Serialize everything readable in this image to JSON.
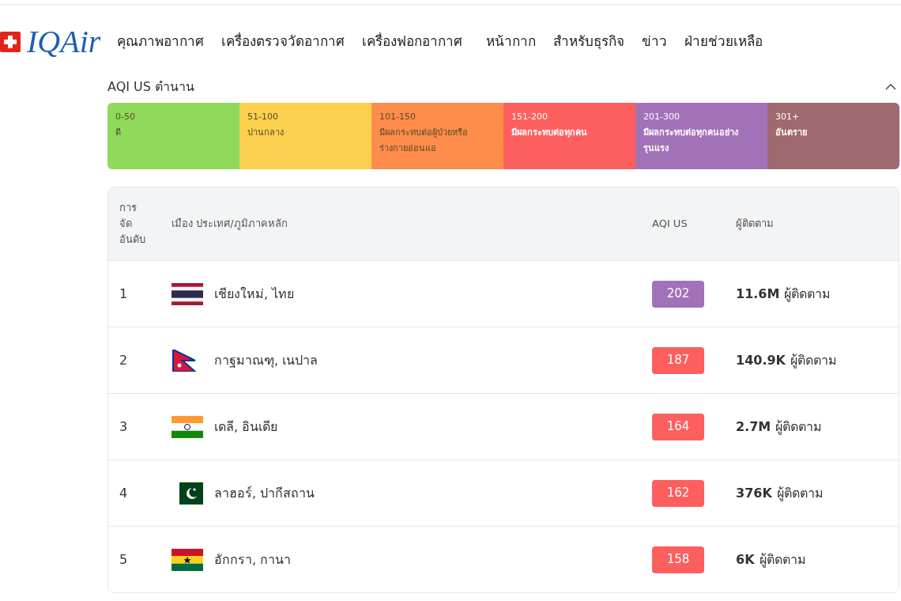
{
  "logo": {
    "text": "IQAir"
  },
  "nav": [
    "คุณภาพอากาศ",
    "เครื่องตรวจวัดอากาศ",
    "เครื่องฟอกอากาศ",
    "หน้ากาก",
    "สำหรับธุรกิจ",
    "ข่าว",
    "ฝ่ายช่วยเหลือ"
  ],
  "legend": {
    "title": "AQI US ตำนาน",
    "expanded": true,
    "items": [
      {
        "range": "0-50",
        "label": "ดี",
        "color": "#8fd95b"
      },
      {
        "range": "51-100",
        "label": "ปานกลาง",
        "color": "#fbd04e"
      },
      {
        "range": "101-150",
        "label": "มีผลกระทบต่อผู้ป่วยหรือร่างกายอ่อนแอ",
        "color": "#fe8c4a"
      },
      {
        "range": "151-200",
        "label": "มีผลกระทบต่อทุกคน",
        "color": "#fd5f5f"
      },
      {
        "range": "201-300",
        "label": "มีผลกระทบต่อทุกคนอย่างรุนแรง",
        "color": "#a272b8"
      },
      {
        "range": "301+",
        "label": "อันตราย",
        "color": "#a0686f"
      }
    ]
  },
  "table": {
    "columns": [
      "การ จัด อันดับ",
      "เมือง ประเทศ/ภูมิภาคหลัก",
      "AQI US",
      "ผู้ติดตาม"
    ],
    "rows": [
      {
        "rank": "1",
        "city": "เชียงใหม่, ไทย",
        "aqi": "202",
        "color": "#a272b8",
        "followers": "11.6M",
        "followers_label": "ผู้ติดตาม"
      },
      {
        "rank": "2",
        "city": "กาฐมาณฑุ, เนปาล",
        "aqi": "187",
        "color": "#fd5f5f",
        "followers": "140.9K",
        "followers_label": "ผู้ติดตาม"
      },
      {
        "rank": "3",
        "city": "เดลี, อินเดีย",
        "aqi": "164",
        "color": "#fd5f5f",
        "followers": "2.7M",
        "followers_label": "ผู้ติดตาม"
      },
      {
        "rank": "4",
        "city": "ลาฮอร์, ปากีสถาน",
        "aqi": "162",
        "color": "#fd5f5f",
        "followers": "376K",
        "followers_label": "ผู้ติดตาม"
      },
      {
        "rank": "5",
        "city": "อักกรา, กานา",
        "aqi": "158",
        "color": "#fd5f5f",
        "followers": "6K",
        "followers_label": "ผู้ติดตาม"
      }
    ]
  }
}
